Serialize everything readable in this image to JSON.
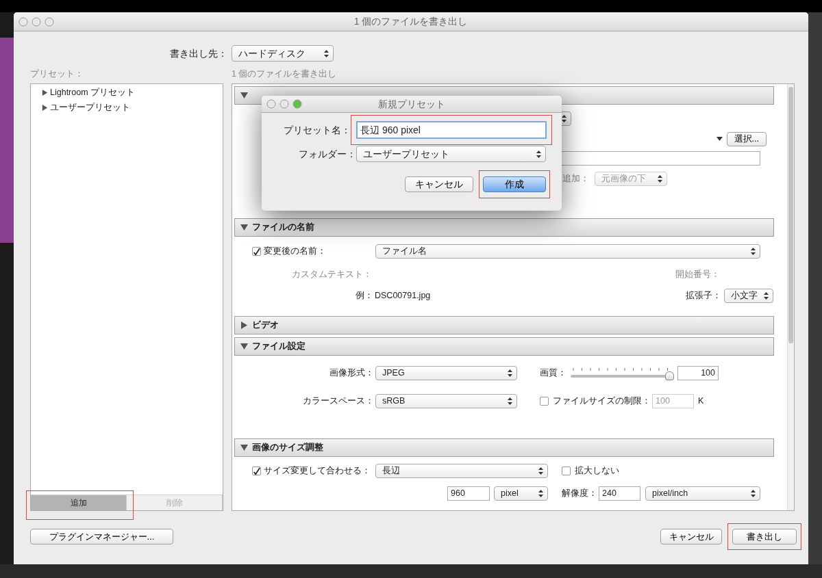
{
  "window": {
    "title": "1 個のファイルを書き出し"
  },
  "destination": {
    "label": "書き出し先：",
    "value": "ハードディスク"
  },
  "presets": {
    "label": "プリセット：",
    "items": [
      {
        "label": "Lightroom プリセット",
        "expanded": false
      },
      {
        "label": "ユーザープリセット",
        "expanded": false
      }
    ],
    "add_button": {
      "label": "追加",
      "disabled": false
    },
    "remove_button": {
      "label": "削除",
      "disabled": true
    }
  },
  "subtitle": "1 個のファイルを書き出し",
  "sections": [
    {
      "kind": "location",
      "expanded": true,
      "choose_button": "選択...",
      "add_label": "追加：",
      "add_select": {
        "value": "元画像の下",
        "disabled": true
      }
    },
    {
      "kind": "naming",
      "title": "ファイルの名前",
      "expanded": true,
      "rename": {
        "checked": true,
        "label": "変更後の名前：",
        "value": "ファイル名"
      },
      "custom_text_label": "カスタムテキスト：",
      "start_number_label": "開始番号：",
      "example_label": "例：",
      "example": "DSC00791.jpg",
      "extension_label": "拡張子：",
      "extension": "小文字"
    },
    {
      "title": "ビデオ",
      "expanded": false
    },
    {
      "kind": "file_settings",
      "title": "ファイル設定",
      "expanded": true,
      "format_label": "画像形式：",
      "format": "JPEG",
      "quality_label": "画質：",
      "quality": {
        "level": 1.0
      },
      "quality_value": "100",
      "color_space_label": "カラースペース：",
      "color_space": "sRGB",
      "limit": {
        "checked": false,
        "label": "ファイルサイズの制限：",
        "value": "100",
        "unit": "K"
      }
    },
    {
      "kind": "sizing",
      "title": "画像のサイズ調整",
      "expanded": true,
      "resize": {
        "checked": true,
        "label": "サイズ変更して合わせる：",
        "value": "長辺"
      },
      "dont_enlarge": {
        "checked": false,
        "label": "拡大しない"
      },
      "size": "960",
      "size_unit": "pixel",
      "resolution_label": "解像度：",
      "resolution": "240",
      "resolution_unit": "pixel/inch"
    }
  ],
  "plugin_button": "プラグインマネージャー...",
  "cancel_button": "キャンセル",
  "export_button": "書き出し",
  "new_preset_dialog": {
    "title": "新規プリセット",
    "name_label": "プリセット名：",
    "name": "長辺 960 pixel",
    "folder_label": "フォルダー：",
    "folder": "ユーザープリセット",
    "cancel_button": "キャンセル",
    "create_button": "作成"
  }
}
